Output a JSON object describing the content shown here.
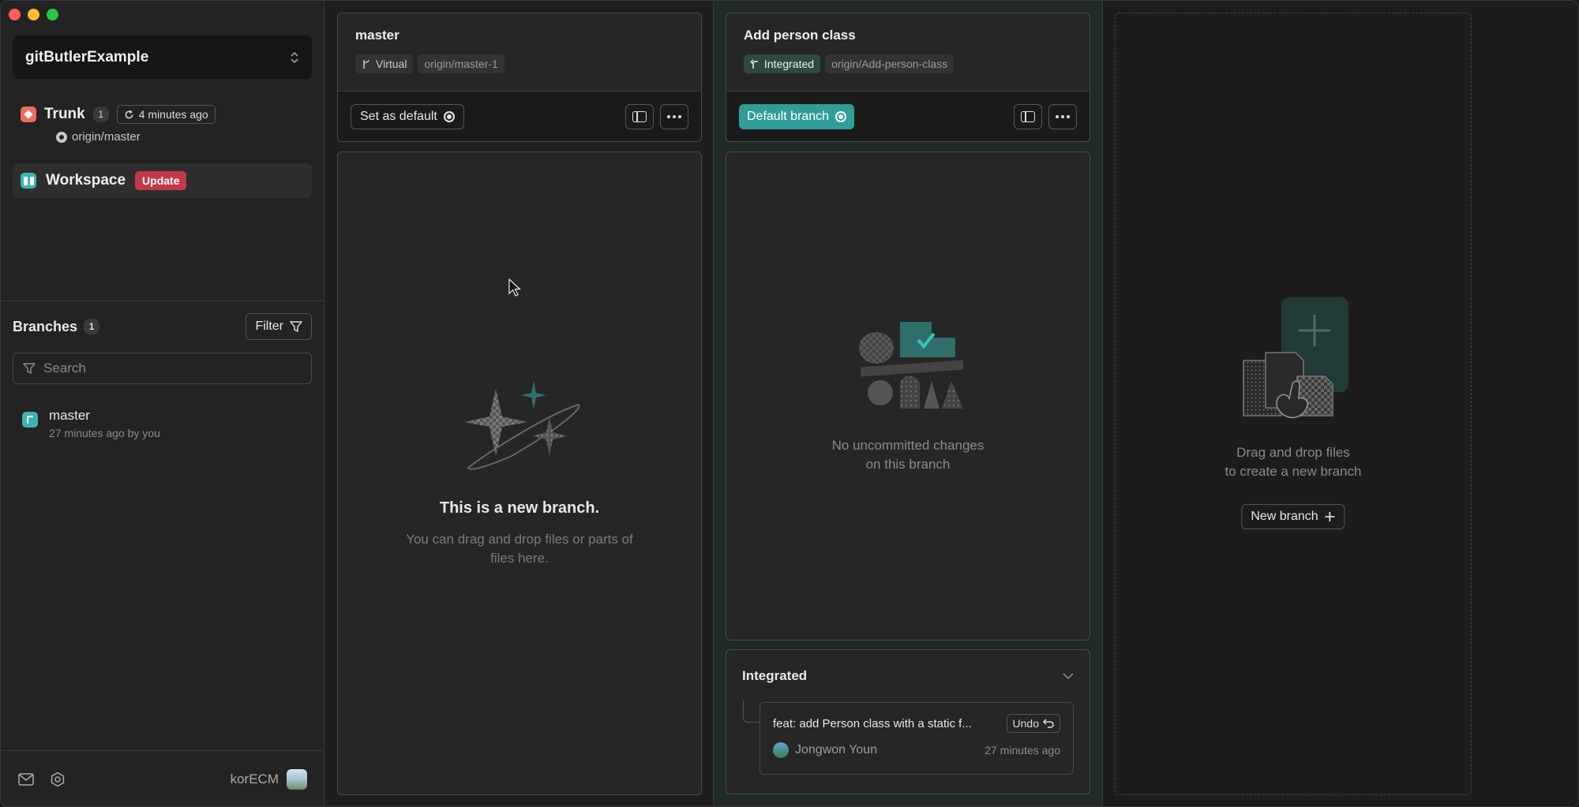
{
  "project": {
    "name": "gitButlerExample"
  },
  "sidebar": {
    "trunk": {
      "label": "Trunk",
      "count": "1",
      "time": "4 minutes ago",
      "remote": "origin/master"
    },
    "workspace": {
      "label": "Workspace",
      "badge": "Update"
    },
    "branches": {
      "title": "Branches",
      "count": "1",
      "filter_label": "Filter",
      "search_placeholder": "Search",
      "items": [
        {
          "name": "master",
          "meta": "27 minutes ago by you"
        }
      ]
    },
    "footer": {
      "username": "korECM"
    }
  },
  "lanes": [
    {
      "title": "master",
      "tags": [
        "Virtual",
        "origin/master-1"
      ],
      "action_label": "Set as default",
      "empty_title": "This is a new branch.",
      "empty_sub": "You can drag and drop files or parts of files here."
    },
    {
      "title": "Add person class",
      "tags": [
        "Integrated",
        "origin/Add-person-class"
      ],
      "action_label": "Default branch",
      "empty_line1": "No uncommitted changes",
      "empty_line2": "on this branch",
      "integrated": {
        "title": "Integrated",
        "commit_message": "feat: add Person class with a static f...",
        "undo_label": "Undo",
        "author": "Jongwon Youn",
        "time": "27 minutes ago"
      }
    }
  ],
  "new_branch_zone": {
    "line1": "Drag and drop files",
    "line2": "to create a new branch",
    "button_label": "New branch"
  },
  "colors": {
    "accent_teal": "#2f9e96",
    "update_red": "#c23a48",
    "trunk_red": "#f06c57"
  }
}
